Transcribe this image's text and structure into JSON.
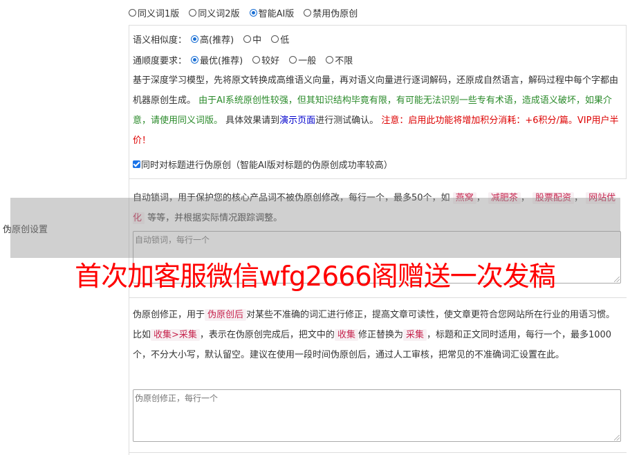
{
  "section_label": "伪原创设置",
  "modes": [
    {
      "label": "同义词1版",
      "selected": false
    },
    {
      "label": "同义词2版",
      "selected": false
    },
    {
      "label": "智能AI版",
      "selected": true
    },
    {
      "label": "禁用伪原创",
      "selected": false
    }
  ],
  "similarity": {
    "label": "语义相似度：",
    "options": [
      {
        "label": "高(推荐)",
        "selected": true
      },
      {
        "label": "中",
        "selected": false
      },
      {
        "label": "低",
        "selected": false
      }
    ]
  },
  "fluency": {
    "label": "通顺度要求：",
    "options": [
      {
        "label": "最优(推荐)",
        "selected": true
      },
      {
        "label": "较好",
        "selected": false
      },
      {
        "label": "一般",
        "selected": false
      },
      {
        "label": "不限",
        "selected": false
      }
    ]
  },
  "ai_description": {
    "text1": "基于深度学习模型，先将原文转换成高维语义向量，再对语义向量进行逐词解码，还原成自然语言，解码过程中每个字都由机器原创生成。",
    "green": "由于AI系统原创性较强，但其知识结构毕竟有限，有可能无法识别一些专有术语，造成语义破坏，如果介意，请使用同义词版。",
    "text2": "具体效果请到",
    "link": "演示页面",
    "text3": "进行测试确认。",
    "red": "注意：启用此功能将增加积分消耗：+6积分/篇。VIP用户半价！"
  },
  "title_checkbox": {
    "label": "同时对标题进行伪原创（智能AI版对标题的伪原创成功率较高）",
    "checked": true
  },
  "lock_words": {
    "text1": "自动锁词，用于保护您的核心产品词不被伪原创修改，每行一个，最多50个，如",
    "tags": [
      "燕窝",
      "减肥茶",
      "股票配资",
      "网站优化"
    ],
    "text2": "等等，并根据实际情况跟踪调整。",
    "placeholder": "自动锁词，每行一个"
  },
  "correction": {
    "text1": "伪原创修正，用于",
    "tag1": "伪原创后",
    "text2": "对某些不准确的词汇进行修正，提高文章可读性，使文章更符合您网站所在行业的用语习惯。比如",
    "tag2": "收集>采集",
    "text3": "，表示在伪原创完成后，把文中的",
    "tag3": "收集",
    "text4": "修正替换为",
    "tag4": "采集",
    "text5": "，标题和正文同时适用，每行一个，最多1000个，不分大小写，默认留空。建议在使用一段时间伪原创后，通过人工审核，把常见的不准确词汇设置在此。",
    "placeholder": "伪原创修正，每行一个"
  },
  "watermark": "首次加客服微信wfg2666阁赠送一次发稿"
}
